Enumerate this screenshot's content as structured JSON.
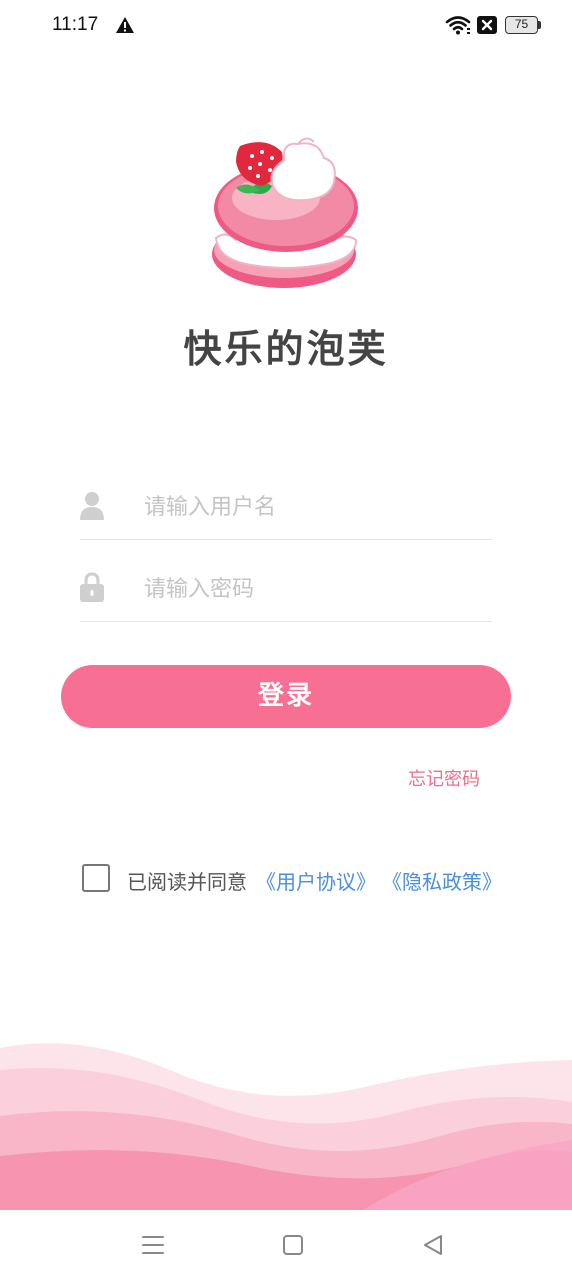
{
  "status_bar": {
    "time": "11:17",
    "battery": "75",
    "icons": [
      "warning-icon",
      "wifi-icon",
      "close-box-icon",
      "battery-icon"
    ]
  },
  "app": {
    "title": "快乐的泡芙",
    "logo_icon": "cream-puff-strawberry-logo"
  },
  "form": {
    "username_placeholder": "请输入用户名",
    "password_placeholder": "请输入密码",
    "username_icon": "person-icon",
    "password_icon": "lock-icon",
    "login_label": "登录",
    "forgot_label": "忘记密码"
  },
  "agreement": {
    "checked": false,
    "text": "已阅读并同意",
    "user_agreement": "《用户协议》",
    "privacy_policy": "《隐私政策》"
  },
  "nav": {
    "icons": [
      "menu-icon",
      "home-square-icon",
      "back-triangle-icon"
    ]
  },
  "colors": {
    "primary": "#f76f93",
    "link": "#4a8fdd",
    "forgot": "#ec6d8d",
    "title": "#444444"
  }
}
